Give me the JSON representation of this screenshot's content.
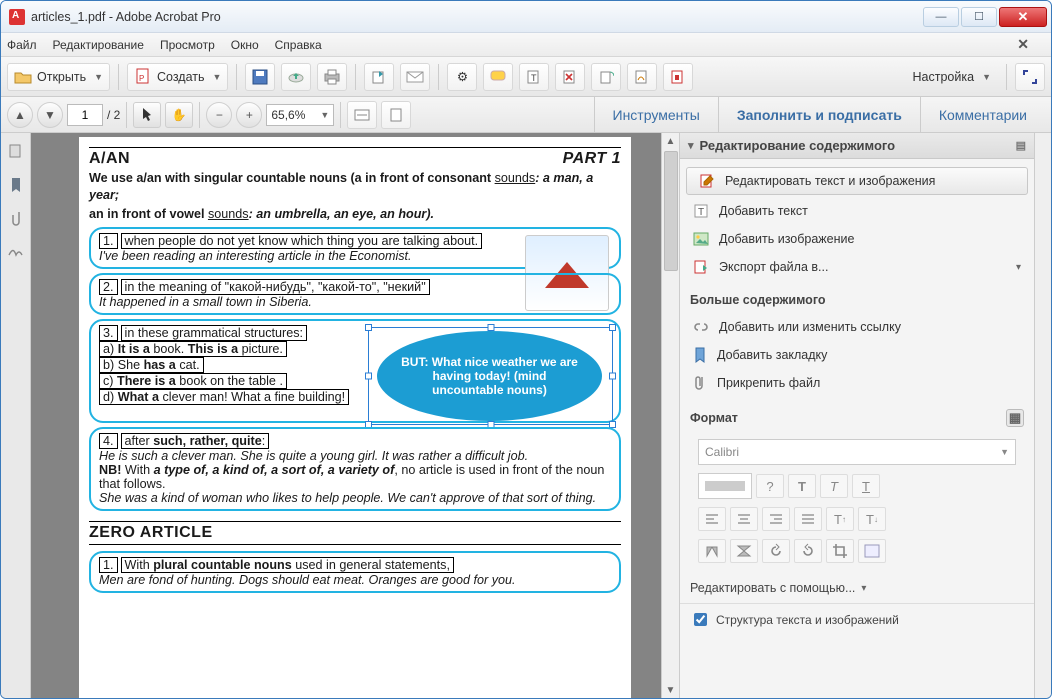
{
  "window": {
    "title": "articles_1.pdf - Adobe Acrobat Pro"
  },
  "menu": {
    "file": "Файл",
    "edit": "Редактирование",
    "view": "Просмотр",
    "window": "Окно",
    "help": "Справка"
  },
  "toolbar": {
    "open": "Открыть",
    "create": "Создать",
    "customize": "Настройка"
  },
  "pager": {
    "page": "1",
    "of": "/ 2",
    "zoom": "65,6%"
  },
  "modes": {
    "tools": "Инструменты",
    "fill": "Заполнить и подписать",
    "comments": "Комментарии"
  },
  "edit_panel": {
    "title": "Редактирование содержимого",
    "edit_text_img": "Редактировать текст и изображения",
    "add_text": "Добавить текст",
    "add_image": "Добавить изображение",
    "export_file": "Экспорт файла в...",
    "more_content": "Больше содержимого",
    "add_link": "Добавить или изменить ссылку",
    "add_bookmark": "Добавить закладку",
    "attach_file": "Прикрепить файл",
    "format": "Формат",
    "font": "Calibri",
    "question": "?",
    "help_with": "Редактировать с помощью...",
    "structure": "Структура текста и изображений"
  },
  "doc": {
    "h1_left": "A/AN",
    "h1_right": "PART 1",
    "intro1": "We use a/an with singular countable nouns (a in front of consonant ",
    "sounds": "sounds",
    "intro2": ": a man, a year;",
    "intro3": "an in front of vowel ",
    "intro4": ": an umbrella, an eye, an hour).",
    "b1_num": "1.",
    "b1_t": "when people do not yet know which thing you are talking about.",
    "b1_e": "I've been reading an interesting article in the Economist.",
    "b2_num": "2.",
    "b2_t": "in the meaning of \"какой-нибудь\", \"какой-то\", \"некий\"",
    "b2_e": "It happened in a small town in Siberia.",
    "b3_num": "3.",
    "b3_t": "in these grammatical structures:",
    "b3_a": "a) It is a book. This is a picture.",
    "b3_b": "b) She has a cat.",
    "b3_c": "c) There is a book on the table .",
    "b3_d": "d) What a clever man! What a fine building!",
    "ellipse": "BUT: What nice weather we are having today! (mind uncountable nouns)",
    "b4_num": "4.",
    "b4_t": "after such, rather, quite:",
    "b4_e1": "He is such a clever man.   She is quite a young girl.   It was rather a difficult job.",
    "b4_e2a": "NB! With a type of, a kind of, a sort of, a variety of, ",
    "b4_e2b": "no article is used in front of the noun that follows.",
    "b4_e3": "She was a kind of woman who likes to help people.    We can't approve of that sort of thing.",
    "h2": "ZERO ARTICLE",
    "z1_num": "1.",
    "z1_t": "With plural countable nouns used in general statements,",
    "z1_e": "Men are fond of hunting.       Dogs should eat meat.       Oranges are good for you."
  }
}
